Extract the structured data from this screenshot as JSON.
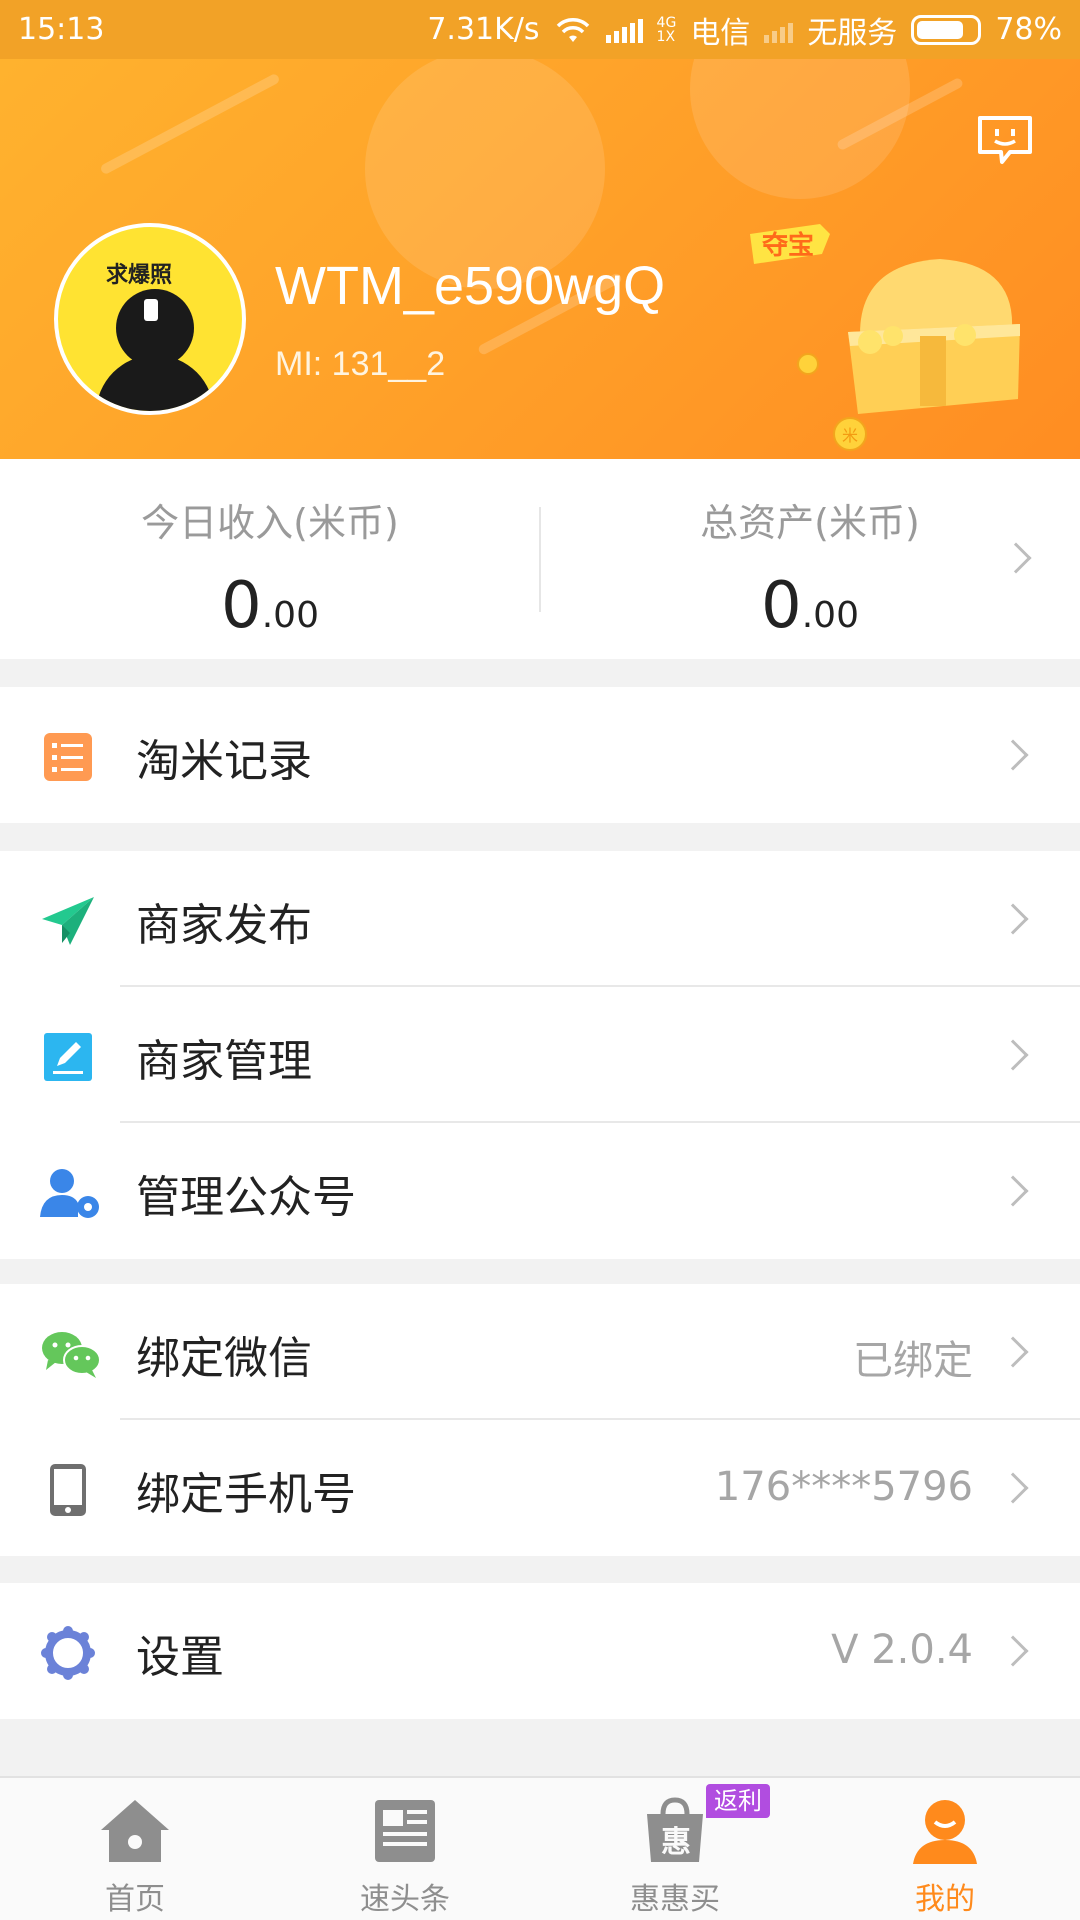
{
  "status_bar": {
    "time": "15:13",
    "speed": "7.31K/s",
    "net_top": "4G",
    "net_bottom": "1X",
    "carrier": "电信",
    "no_service": "无服务",
    "battery": "78%",
    "battery_level": 0.78
  },
  "profile": {
    "username": "WTM_e590wgQ",
    "mi_id": "MI: 131__2",
    "avatar_caption": "求爆照",
    "chest_label": "夺宝",
    "chest_coin_mark": "米"
  },
  "stats": {
    "today_label": "今日收入(米币)",
    "today_int": "0",
    "today_dec": ".00",
    "total_label": "总资产(米币)",
    "total_int": "0",
    "total_dec": ".00"
  },
  "menu": {
    "taomi_records": "淘米记录",
    "merchant_publish": "商家发布",
    "merchant_manage": "商家管理",
    "manage_official": "管理公众号",
    "bind_wechat": "绑定微信",
    "bind_wechat_value": "已绑定",
    "bind_phone": "绑定手机号",
    "bind_phone_value": "176****5796",
    "settings": "设置",
    "settings_value": "V 2.0.4"
  },
  "tabs": {
    "home": "首页",
    "news": "速头条",
    "buy": "惠惠买",
    "buy_icon_char": "惠",
    "buy_badge": "返利",
    "mine": "我的"
  },
  "colors": {
    "accent": "#ff8a1c",
    "header_start": "#ffb22e",
    "header_end": "#ff8d22",
    "badge": "#b14de0"
  }
}
